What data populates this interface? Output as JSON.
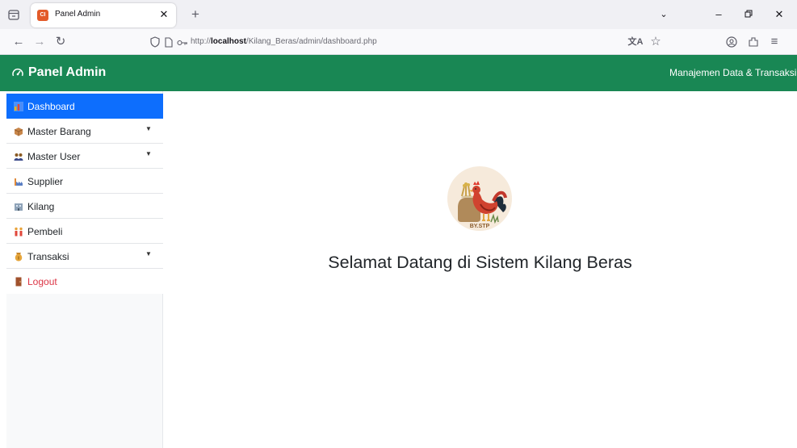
{
  "browser": {
    "tab": {
      "title": "Panel Admin",
      "favicon": "CI"
    },
    "url": {
      "prefix": "http://",
      "host": "localhost",
      "path": "/Kilang_Beras/admin/dashboard.php"
    },
    "icons": [
      "tab-overview-icon",
      "close-icon",
      "plus-icon",
      "chevron-down-icon",
      "minimize-icon",
      "restore-icon",
      "close-window-icon",
      "back-arrow-icon",
      "forward-arrow-icon",
      "reload-icon",
      "shield-icon",
      "page-icon",
      "key-icon",
      "translate-icon",
      "star-icon",
      "account-icon",
      "extensions-icon",
      "menu-icon"
    ]
  },
  "header": {
    "brand": "Panel Admin",
    "subtitle": "Manajemen Data & Transaksi",
    "color": "#198754"
  },
  "sidebar": {
    "items": [
      {
        "label": "Dashboard",
        "icon": "bar-chart-icon",
        "active": true
      },
      {
        "label": "Master Barang",
        "icon": "package-icon",
        "dropdown": true
      },
      {
        "label": "Master User",
        "icon": "users-icon",
        "dropdown": true
      },
      {
        "label": "Supplier",
        "icon": "factory-icon"
      },
      {
        "label": "Kilang",
        "icon": "building-icon"
      },
      {
        "label": "Pembeli",
        "icon": "people-icon"
      },
      {
        "label": "Transaksi",
        "icon": "money-bag-icon",
        "dropdown": true
      },
      {
        "label": "Logout",
        "icon": "door-icon"
      }
    ],
    "active_color": "#0d6efd",
    "logout_color": "#dc3545"
  },
  "main": {
    "logo": {
      "text": "BY.STP",
      "icon": "rooster-rice-logo"
    },
    "welcome": "Selamat Datang di Sistem Kilang Beras"
  }
}
